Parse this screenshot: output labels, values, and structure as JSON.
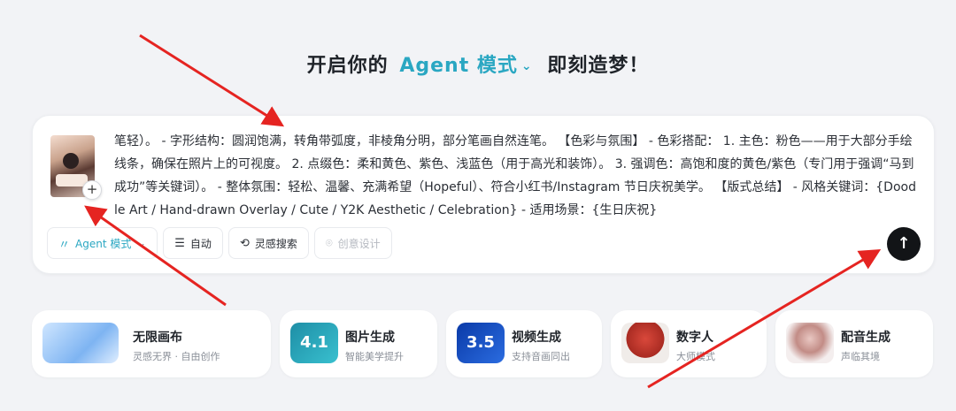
{
  "heading": {
    "prefix": "开启你的",
    "accent": "Agent 模式",
    "suffix": "即刻造梦！"
  },
  "prompt": {
    "text": "笔轻）。 - 字形结构：圆润饱满，转角带弧度，非棱角分明，部分笔画自然连笔。 【色彩与氛围】 - 色彩搭配： 1. 主色：粉色——用于大部分手绘线条，确保在照片上的可视度。 2. 点缀色：柔和黄色、紫色、浅蓝色（用于高光和装饰）。 3. 强调色：高饱和度的黄色/紫色（专门用于强调“马到成功”等关键词）。 - 整体氛围：轻松、温馨、充满希望（Hopeful）、符合小红书/Instagram 节日庆祝美学。 【版式总结】 - 风格关键词：{Doodle Art / Hand-drawn Overlay / Cute / Y2K Aesthetic / Celebration} - 适用场景：{生日庆祝}"
  },
  "toolbar": {
    "agent_label": "Agent 模式",
    "auto_label": "自动",
    "inspiration_label": "灵感搜索",
    "creative_label": "创意设计"
  },
  "features": [
    {
      "title": "无限画布",
      "subtitle": "灵感无界 · 自由创作"
    },
    {
      "title": "图片生成",
      "subtitle": "智能美学提升",
      "badge": "4.1"
    },
    {
      "title": "视频生成",
      "subtitle": "支持音画同出",
      "badge": "3.5"
    },
    {
      "title": "数字人",
      "subtitle": "大师模式"
    },
    {
      "title": "配音生成",
      "subtitle": "声临其境"
    }
  ],
  "colors": {
    "accent": "#2aa7c2",
    "arrow": "#e52421",
    "send_button": "#121417"
  }
}
